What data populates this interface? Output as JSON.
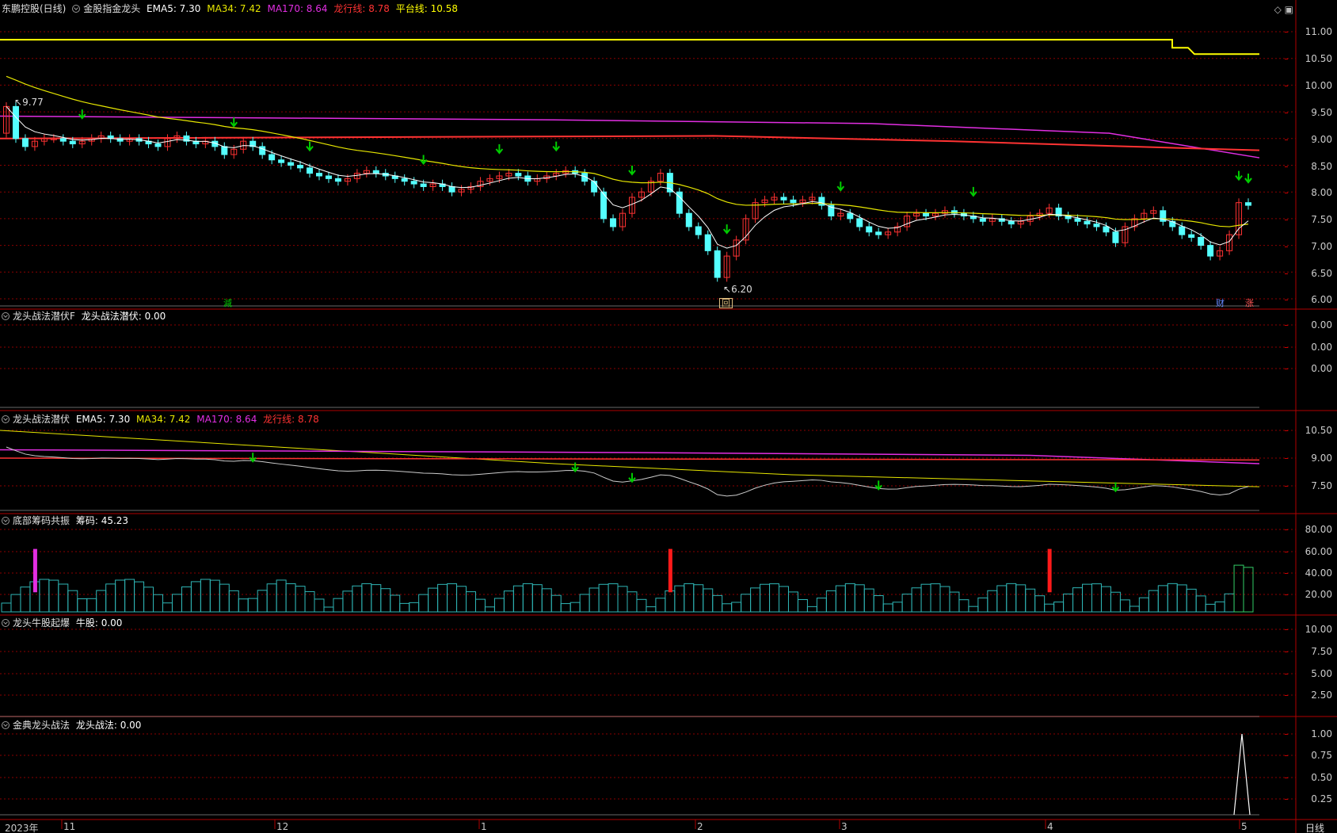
{
  "colors": {
    "ema5": "#ffffff",
    "ma34": "#e6e600",
    "ma170": "#e22ee2",
    "dragon": "#ff3333",
    "platform": "#ffff00",
    "up": "#ff3232",
    "down": "#54ffff",
    "signal": "#00cc00",
    "grid": "#8b0000"
  },
  "header": {
    "stock": "东鹏控股(日线)",
    "indicator": "金股指金龙头",
    "ema5": "EMA5: 7.30",
    "ma34": "MA34: 7.42",
    "ma170": "MA170: 8.64",
    "dragon": "龙行线: 8.78",
    "platform": "平台线: 10.58"
  },
  "corner_icons": [
    "diamond-icon",
    "window-icon"
  ],
  "main_panel": {
    "y_ticks": [
      "11.00",
      "10.50",
      "10.00",
      "9.50",
      "9.00",
      "8.50",
      "8.00",
      "7.50",
      "7.00",
      "6.50",
      "6.00"
    ],
    "high_label": "9.77",
    "low_label": "6.20",
    "markers": [
      {
        "text": "減",
        "color": "#00cc00"
      },
      {
        "text": "回",
        "color": "#e0c080"
      },
      {
        "text": "财",
        "color": "#6688ff"
      },
      {
        "text": "涨",
        "color": "#ff5555"
      }
    ]
  },
  "panel2": {
    "name": "龙头战法潜伏F",
    "value_label": "龙头战法潜伏: 0.00",
    "y_ticks": [
      "0.00",
      "0.00",
      "0.00"
    ]
  },
  "panel3": {
    "name": "龙头战法潜伏",
    "ema5": "EMA5: 7.30",
    "ma34": "MA34: 7.42",
    "ma170": "MA170: 8.64",
    "dragon": "龙行线: 8.78",
    "y_ticks": [
      "10.50",
      "9.00",
      "7.50"
    ]
  },
  "panel4": {
    "name": "底部筹码共振",
    "value_label": "筹码: 45.23",
    "y_ticks": [
      "80.00",
      "60.00",
      "40.00",
      "20.00"
    ]
  },
  "panel5": {
    "name": "龙头牛股起爆",
    "value_label": "牛股: 0.00",
    "y_ticks": [
      "10.00",
      "7.50",
      "5.00",
      "2.50"
    ]
  },
  "panel6": {
    "name": "金典龙头战法",
    "value_label": "龙头战法: 0.00",
    "y_ticks": [
      "1.00",
      "0.75",
      "0.50",
      "0.25"
    ]
  },
  "date_axis": {
    "labels": [
      "2023年",
      "11",
      "12",
      "1",
      "2",
      "3",
      "4",
      "5"
    ],
    "period": "日线"
  },
  "chart_data": {
    "type": "candlestick",
    "period": "日线",
    "approx_closes": [
      9.6,
      9.0,
      8.85,
      8.95,
      9.0,
      9.0,
      8.95,
      8.9,
      8.95,
      9.0,
      9.05,
      9.0,
      8.95,
      9.0,
      8.95,
      8.9,
      8.85,
      9.0,
      9.05,
      8.95,
      8.9,
      8.95,
      8.85,
      8.7,
      8.8,
      8.95,
      8.85,
      8.7,
      8.6,
      8.55,
      8.5,
      8.45,
      8.35,
      8.3,
      8.25,
      8.2,
      8.25,
      8.35,
      8.4,
      8.35,
      8.3,
      8.25,
      8.2,
      8.15,
      8.1,
      8.15,
      8.1,
      8.0,
      8.05,
      8.1,
      8.2,
      8.25,
      8.3,
      8.35,
      8.3,
      8.2,
      8.25,
      8.3,
      8.35,
      8.4,
      8.35,
      8.2,
      8.0,
      7.5,
      7.35,
      7.6,
      7.9,
      8.0,
      8.2,
      8.35,
      8.0,
      7.6,
      7.35,
      7.2,
      6.9,
      6.4,
      6.8,
      7.1,
      7.5,
      7.8,
      7.85,
      7.9,
      7.85,
      7.8,
      7.85,
      7.9,
      7.75,
      7.55,
      7.6,
      7.5,
      7.35,
      7.25,
      7.2,
      7.25,
      7.35,
      7.55,
      7.6,
      7.55,
      7.6,
      7.65,
      7.6,
      7.55,
      7.5,
      7.45,
      7.5,
      7.45,
      7.4,
      7.45,
      7.55,
      7.6,
      7.7,
      7.55,
      7.5,
      7.45,
      7.4,
      7.35,
      7.25,
      7.05,
      7.35,
      7.5,
      7.6,
      7.65,
      7.45,
      7.35,
      7.2,
      7.15,
      7.0,
      6.8,
      6.9,
      7.2,
      7.8,
      7.75
    ],
    "ema5": 7.3,
    "ma34": 7.42,
    "ma170": 8.64,
    "dragon_line": 8.78,
    "platform_line": 10.58,
    "high": 9.77,
    "low": 6.2,
    "chip_value": 45.23
  }
}
